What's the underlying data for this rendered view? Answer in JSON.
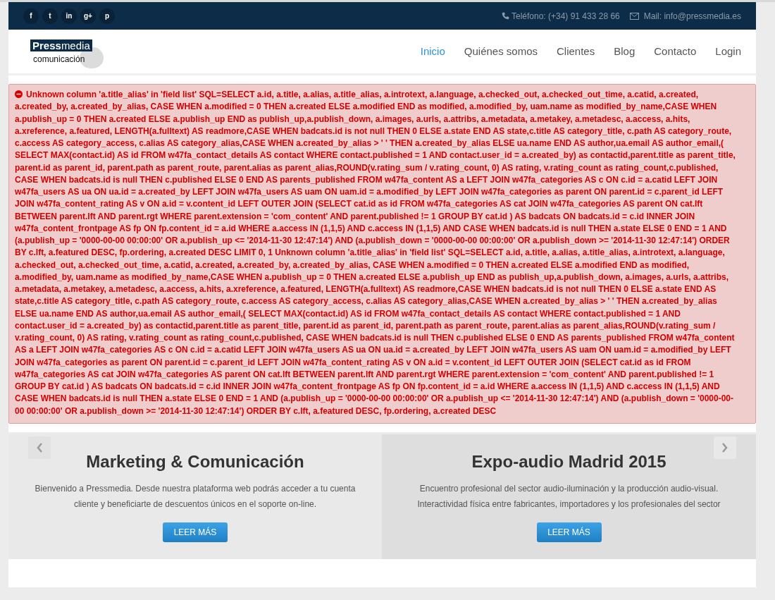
{
  "top_bar": {
    "social_links": [
      "f",
      "t",
      "in",
      "g+",
      "p"
    ],
    "phone": "Teléfono: (+34) 91 433 28 66",
    "mail": "Mail: info@pressmedia.es"
  },
  "logo": {
    "brand_bold": "Press",
    "brand_light": "media",
    "tagline": "comunicación"
  },
  "nav": [
    {
      "label": "Inicio",
      "selected": true
    },
    {
      "label": "Quiénes somos",
      "selected": false
    },
    {
      "label": "Clientes",
      "selected": false
    },
    {
      "label": "Blog",
      "selected": false
    },
    {
      "label": "Contacto",
      "selected": false
    },
    {
      "label": "Login",
      "selected": false
    }
  ],
  "error": {
    "message": "Unknown column 'a.title_alias' in 'field list' SQL=SELECT a.id, a.title, a.alias, a.title_alias, a.introtext, a.language, a.checked_out, a.checked_out_time, a.catid, a.created, a.created_by, a.created_by_alias, CASE WHEN a.modified = 0 THEN a.created ELSE a.modified END as modified, a.modified_by, uam.name as modified_by_name,CASE WHEN a.publish_up = 0 THEN a.created ELSE a.publish_up END as publish_up,a.publish_down, a.images, a.urls, a.attribs, a.metadata, a.metakey, a.metadesc, a.access, a.hits, a.xreference, a.featured, LENGTH(a.fulltext) AS readmore,CASE WHEN badcats.id is not null THEN 0 ELSE a.state END AS state,c.title AS category_title, c.path AS category_route, c.access AS category_access, c.alias AS category_alias,CASE WHEN a.created_by_alias > ' ' THEN a.created_by_alias ELSE ua.name END AS author,ua.email AS author_email,( SELECT MAX(contact.id) AS id FROM w47fa_contact_details AS contact WHERE contact.published = 1 AND contact.user_id = a.created_by) as contactid,parent.title as parent_title, parent.id as parent_id, parent.path as parent_route, parent.alias as parent_alias,ROUND(v.rating_sum / v.rating_count, 0) AS rating, v.rating_count as rating_count,c.published, CASE WHEN badcats.id is null THEN c.published ELSE 0 END AS parents_published FROM w47fa_content AS a LEFT JOIN w47fa_categories AS c ON c.id = a.catid LEFT JOIN w47fa_users AS ua ON ua.id = a.created_by LEFT JOIN w47fa_users AS uam ON uam.id = a.modified_by LEFT JOIN w47fa_categories as parent ON parent.id = c.parent_id LEFT JOIN w47fa_content_rating AS v ON a.id = v.content_id LEFT OUTER JOIN (SELECT cat.id as id FROM w47fa_categories AS cat JOIN w47fa_categories AS parent ON cat.lft BETWEEN parent.lft AND parent.rgt WHERE parent.extension = 'com_content' AND parent.published != 1 GROUP BY cat.id ) AS badcats ON badcats.id = c.id INNER JOIN w47fa_content_frontpage AS fp ON fp.content_id = a.id WHERE a.access IN (1,1,5) AND c.access IN (1,1,5) AND CASE WHEN badcats.id is null THEN a.state ELSE 0 END = 1 AND (a.publish_up = '0000-00-00 00:00:00' OR a.publish_up <= '2014-11-30 12:47:14') AND (a.publish_down = '0000-00-00 00:00:00' OR a.publish_down >= '2014-11-30 12:47:14') ORDER BY c.lft, a.featured DESC, fp.ordering, a.created DESC LIMIT 0, 1 Unknown column 'a.title_alias' in 'field list' SQL=SELECT a.id, a.title, a.alias, a.title_alias, a.introtext, a.language, a.checked_out, a.checked_out_time, a.catid, a.created, a.created_by, a.created_by_alias, CASE WHEN a.modified = 0 THEN a.created ELSE a.modified END as modified, a.modified_by, uam.name as modified_by_name,CASE WHEN a.publish_up = 0 THEN a.created ELSE a.publish_up END as publish_up,a.publish_down, a.images, a.urls, a.attribs, a.metadata, a.metakey, a.metadesc, a.access, a.hits, a.xreference, a.featured, LENGTH(a.fulltext) AS readmore,CASE WHEN badcats.id is not null THEN 0 ELSE a.state END AS state,c.title AS category_title, c.path AS category_route, c.access AS category_access, c.alias AS category_alias,CASE WHEN a.created_by_alias > ' ' THEN a.created_by_alias ELSE ua.name END AS author,ua.email AS author_email,( SELECT MAX(contact.id) AS id FROM w47fa_contact_details AS contact WHERE contact.published = 1 AND contact.user_id = a.created_by) as contactid,parent.title as parent_title, parent.id as parent_id, parent.path as parent_route, parent.alias as parent_alias,ROUND(v.rating_sum / v.rating_count, 0) AS rating, v.rating_count as rating_count,c.published, CASE WHEN badcats.id is null THEN c.published ELSE 0 END AS parents_published FROM w47fa_content AS a LEFT JOIN w47fa_categories AS c ON c.id = a.catid LEFT JOIN w47fa_users AS ua ON ua.id = a.created_by LEFT JOIN w47fa_users AS uam ON uam.id = a.modified_by LEFT JOIN w47fa_categories as parent ON parent.id = c.parent_id LEFT JOIN w47fa_content_rating AS v ON a.id = v.content_id LEFT OUTER JOIN (SELECT cat.id as id FROM w47fa_categories AS cat JOIN w47fa_categories AS parent ON cat.lft BETWEEN parent.lft AND parent.rgt WHERE parent.extension = 'com_content' AND parent.published != 1 GROUP BY cat.id ) AS badcats ON badcats.id = c.id INNER JOIN w47fa_content_frontpage AS fp ON fp.content_id = a.id WHERE a.access IN (1,1,5) AND c.access IN (1,1,5) AND CASE WHEN badcats.id is null THEN a.state ELSE 0 END = 1 AND (a.publish_up = '0000-00-00 00:00:00' OR a.publish_up <= '2014-11-30 12:47:14') AND (a.publish_down = '0000-00-00 00:00:00' OR a.publish_down >= '2014-11-30 12:47:14') ORDER BY c.lft, a.featured DESC, fp.ordering, a.created DESC"
  },
  "slides": [
    {
      "title": "Marketing & Comunicación",
      "text": "Bienvenido a Pressmedia. Desde nuestra plataforma web podrás acceder a tu cuenta cliente y beneficiarte de descuentos únicos en el soporte on-line.",
      "button": "LEER MÁS"
    },
    {
      "title": "Expo-audio Madrid 2015",
      "text": "Encuentro profesional del sector audio-iluminación y la producción audio-visual. Interactividad física entre fabricantes, importadores y los profesionales del sector",
      "button": "LEER MÁS"
    }
  ]
}
